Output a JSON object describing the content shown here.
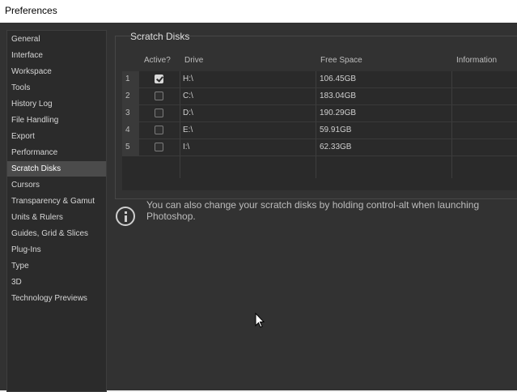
{
  "window": {
    "title": "Preferences"
  },
  "sidebar": {
    "items": [
      {
        "label": "General"
      },
      {
        "label": "Interface"
      },
      {
        "label": "Workspace"
      },
      {
        "label": "Tools"
      },
      {
        "label": "History Log"
      },
      {
        "label": "File Handling"
      },
      {
        "label": "Export"
      },
      {
        "label": "Performance"
      },
      {
        "label": "Scratch Disks",
        "active": true
      },
      {
        "label": "Cursors"
      },
      {
        "label": "Transparency & Gamut"
      },
      {
        "label": "Units & Rulers"
      },
      {
        "label": "Guides, Grid & Slices"
      },
      {
        "label": "Plug-Ins"
      },
      {
        "label": "Type"
      },
      {
        "label": "3D"
      },
      {
        "label": "Technology Previews"
      }
    ]
  },
  "scratch": {
    "title": "Scratch Disks",
    "headers": {
      "active": "Active?",
      "drive": "Drive",
      "free": "Free Space",
      "info": "Information"
    },
    "rows": [
      {
        "num": "1",
        "active": true,
        "drive": "H:\\",
        "free": "106.45GB"
      },
      {
        "num": "2",
        "active": false,
        "drive": "C:\\",
        "free": "183.04GB"
      },
      {
        "num": "3",
        "active": false,
        "drive": "D:\\",
        "free": "190.29GB"
      },
      {
        "num": "4",
        "active": false,
        "drive": "E:\\",
        "free": "59.91GB"
      },
      {
        "num": "5",
        "active": false,
        "drive": "I:\\",
        "free": "62.33GB"
      }
    ]
  },
  "info": {
    "icon": "info-icon",
    "text": "You can also change your scratch disks by holding control-alt when launching Photoshop."
  }
}
